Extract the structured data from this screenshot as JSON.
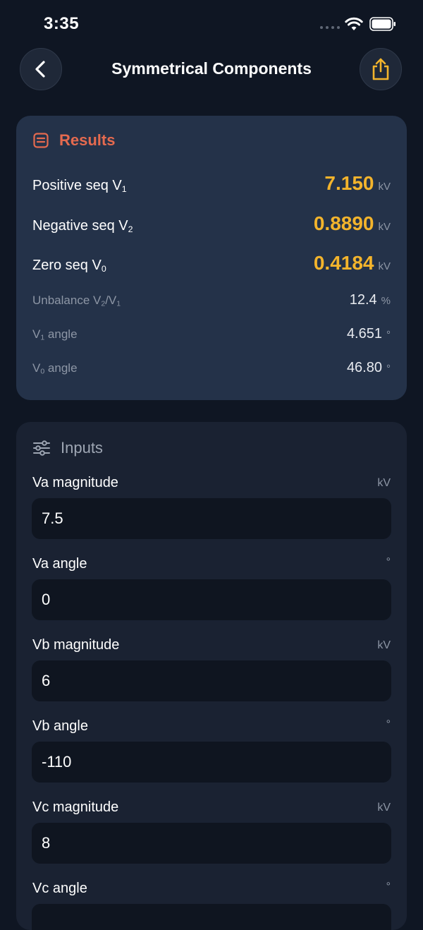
{
  "status": {
    "time": "3:35"
  },
  "nav": {
    "title": "Symmetrical Components",
    "back_icon": "chevron-left-icon",
    "share_icon": "share-icon"
  },
  "colors": {
    "accent": "#f3b42c",
    "results_title": "#e56a4f",
    "card": "#243249",
    "background": "#0f1623"
  },
  "results": {
    "title": "Results",
    "icon": "list-document-icon",
    "rows": [
      {
        "label": "Positive seq V",
        "sub": "1",
        "label_suffix": "",
        "value": "7.150",
        "unit": "kV"
      },
      {
        "label": "Negative seq V",
        "sub": "2",
        "label_suffix": "",
        "value": "0.8890",
        "unit": "kV"
      },
      {
        "label": "Zero seq V",
        "sub": "0",
        "label_suffix": "",
        "value": "0.4184",
        "unit": "kV"
      },
      {
        "label": "Unbalance V",
        "sub": "2",
        "label_mid": "/V",
        "sub2": "1",
        "value": "12.4",
        "unit": "%"
      },
      {
        "label": "V",
        "sub": "1",
        "label_suffix": " angle",
        "value": "4.651",
        "unit": "°"
      },
      {
        "label": "V",
        "sub": "0",
        "label_suffix": " angle",
        "value": "46.80",
        "unit": "°"
      }
    ]
  },
  "inputs": {
    "title": "Inputs",
    "icon": "sliders-icon",
    "fields": [
      {
        "label": "Va magnitude",
        "unit": "kV",
        "value": "7.5"
      },
      {
        "label": "Va angle",
        "unit": "°",
        "value": "0"
      },
      {
        "label": "Vb magnitude",
        "unit": "kV",
        "value": "6"
      },
      {
        "label": "Vb angle",
        "unit": "°",
        "value": "-110"
      },
      {
        "label": "Vc magnitude",
        "unit": "kV",
        "value": "8"
      },
      {
        "label": "Vc angle",
        "unit": "°",
        "value": ""
      }
    ]
  }
}
